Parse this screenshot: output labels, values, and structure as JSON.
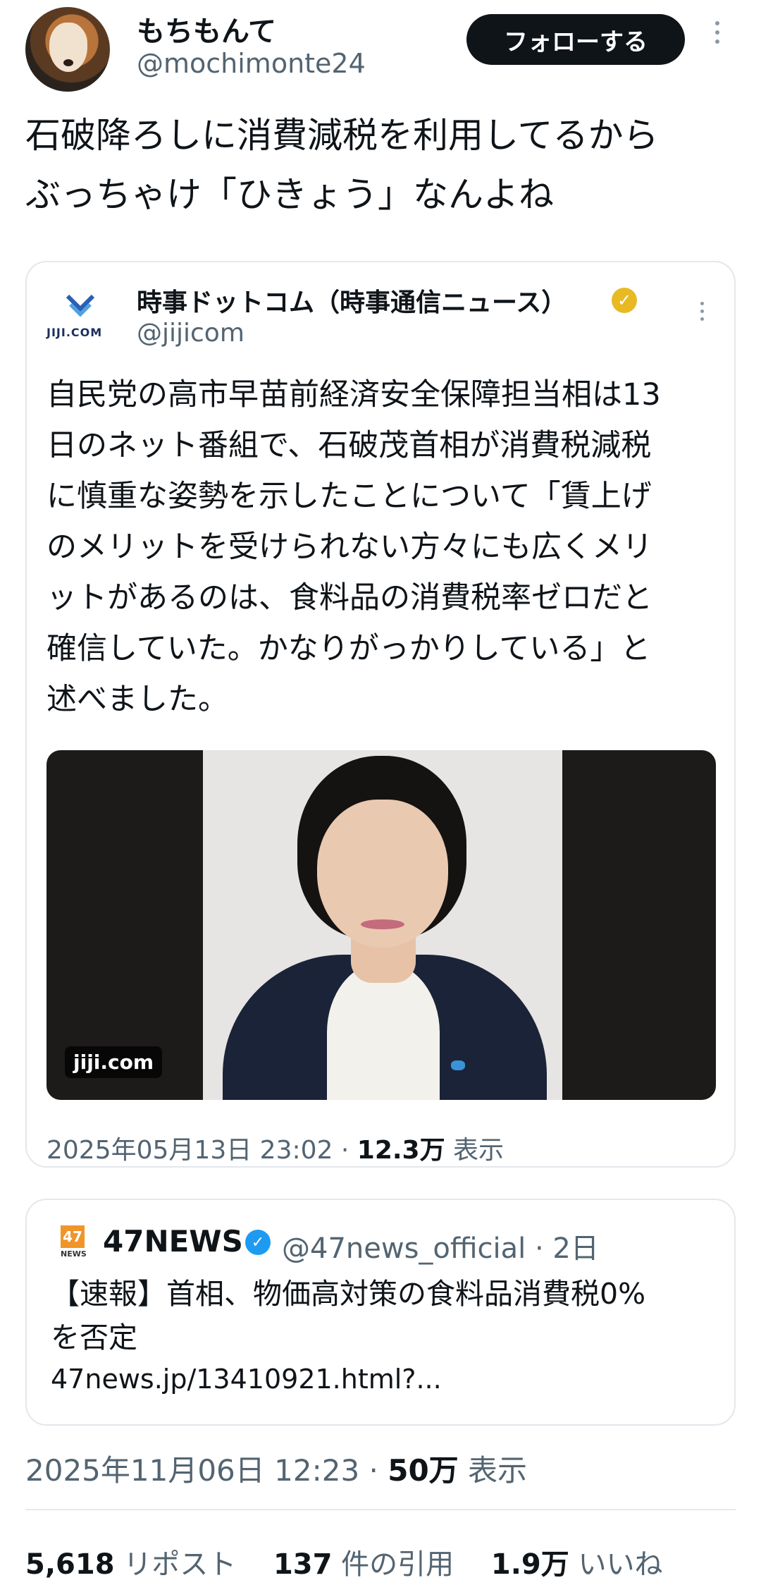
{
  "post": {
    "author_name": "もちもんて",
    "author_handle": "@mochimonte24",
    "follow_label": "フォローする",
    "text_line1": "石破降ろしに消費減税を利用してるから",
    "text_line2": "ぶっちゃけ「ひきょう」なんよね"
  },
  "quote": {
    "logo_text": "JIJI.COM",
    "name": "時事ドットコム（時事通信ニュース）",
    "handle": "@jijicom",
    "lines": [
      "自民党の高市早苗前経済安全保障担当相は13",
      "日のネット番組で、石破茂首相が消費税減税",
      "に慎重な姿勢を示したことについて「賃上げ",
      "のメリットを受けられない方々にも広くメリ",
      "ットがあるのは、食料品の消費税率ゼロだと",
      "確信していた。かなりがっかりしている」と",
      "述べました。"
    ],
    "image_watermark": "jiji.com",
    "date": "2025年05月13日 23:02 · ",
    "views": "12.3万",
    "views_label": " 表示"
  },
  "link_card": {
    "logo": "47",
    "logo_sub": "NEWS",
    "name": "47NEWS",
    "handle": "@47news_official · 2日",
    "text_line1": "【速報】首相、物価高対策の食料品消費税0%",
    "text_line2": "を否定",
    "link": "47news.jp/13410921.html?..."
  },
  "meta": {
    "date": "2025年11月06日 12:23 · ",
    "views": "50万",
    "views_label": " 表示"
  },
  "stats": {
    "reposts": "5,618",
    "reposts_label": " リポスト",
    "quotes": "137",
    "quotes_label": " 件の引用",
    "likes": "1.9万",
    "likes_label": " いいね"
  },
  "colors": {
    "accent": "#1d9bf0",
    "gold_badge": "#e8b923",
    "muted": "#536471"
  }
}
